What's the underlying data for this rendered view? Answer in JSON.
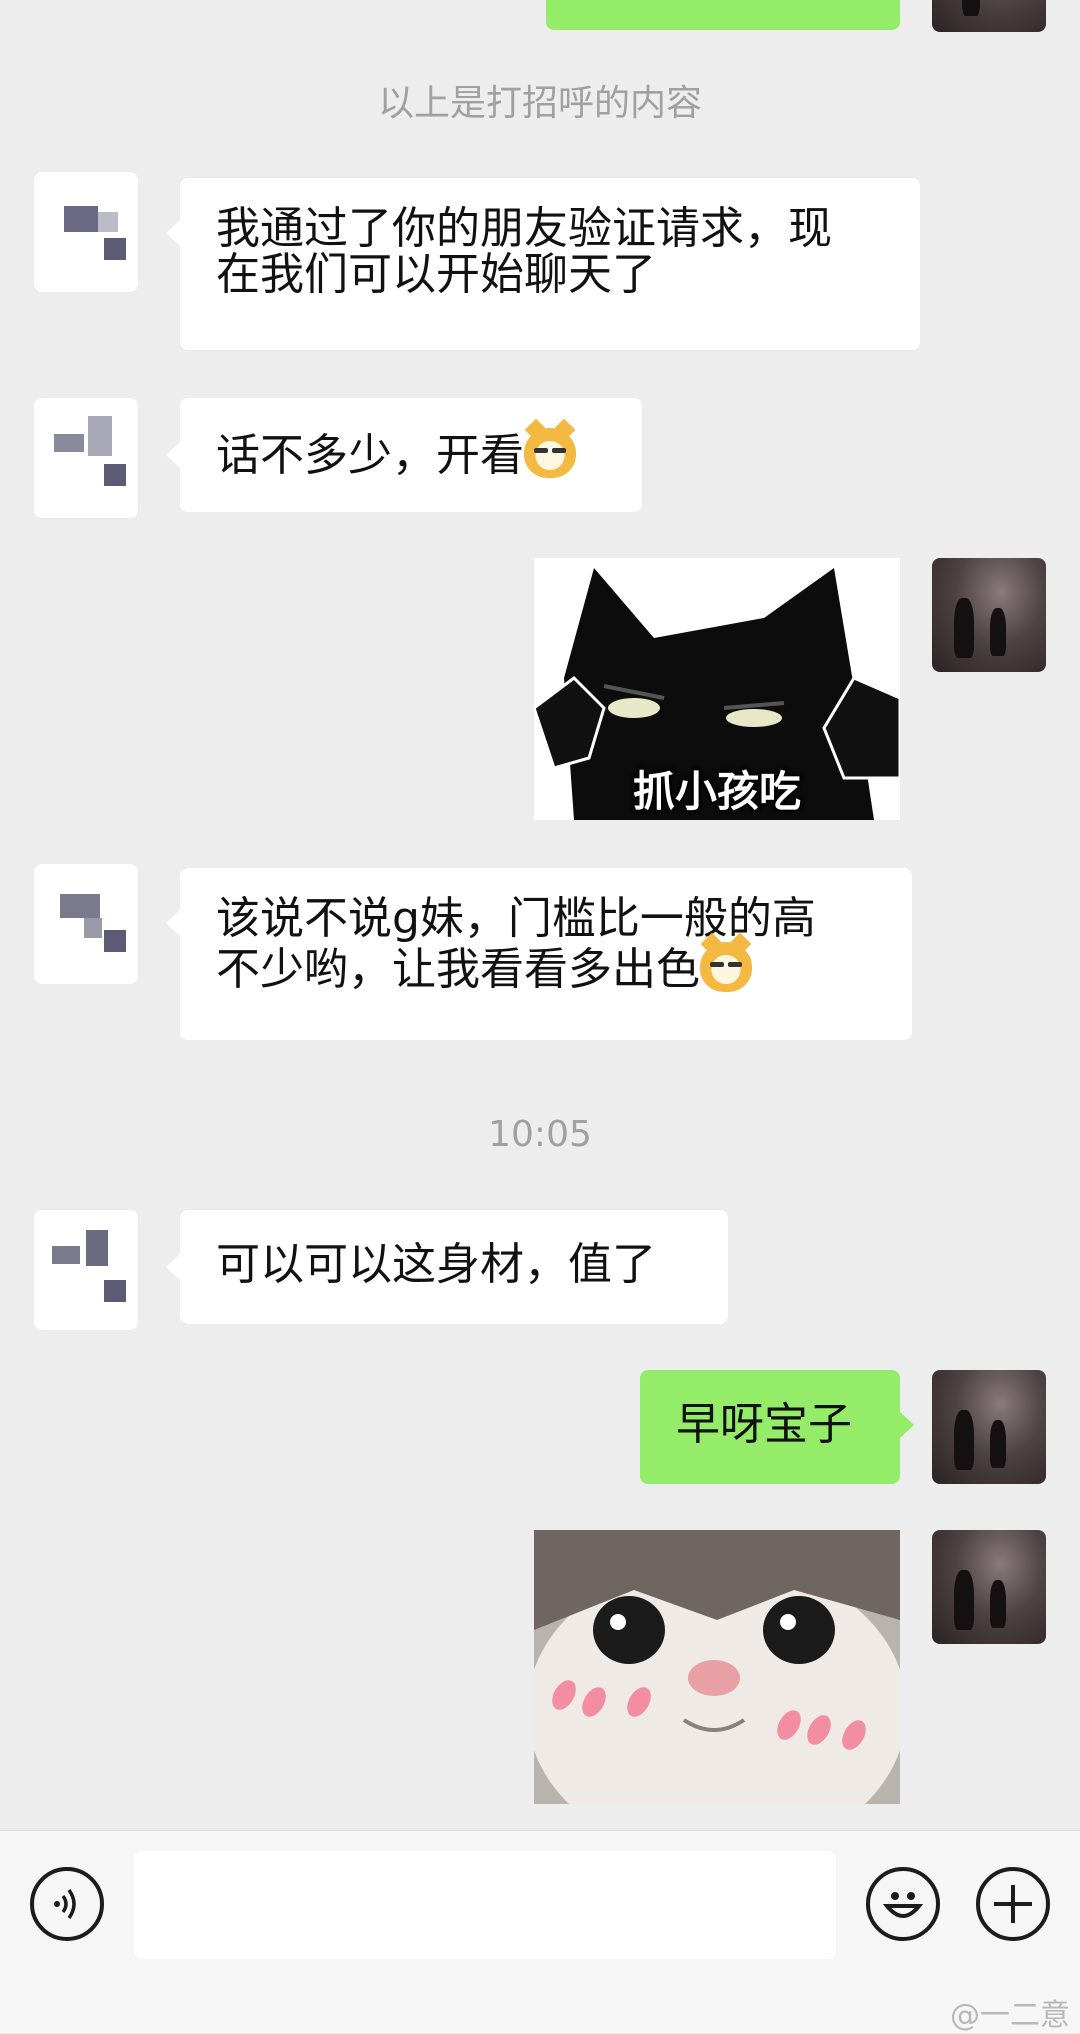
{
  "chat": {
    "system_notice": "以上是打招呼的内容",
    "timestamp": "10:05",
    "messages": [
      {
        "side": "left",
        "text": "我通过了你的朋友验证请求，现在我们可以开始聊天了",
        "line1": "我通过了你的朋友验证请求，现",
        "line2": "在我们可以开始聊天了"
      },
      {
        "side": "left",
        "text": "话不多少，开看",
        "emoji": "doge-emoji"
      },
      {
        "side": "right",
        "type": "sticker",
        "caption": "抓小孩吃"
      },
      {
        "side": "left",
        "line1": "该说不说g妹，门槛比一般的高",
        "line2": "不少哟，让我看看多出色",
        "emoji": "doge-emoji"
      },
      {
        "side": "left",
        "text": "可以可以这身材，值了"
      },
      {
        "side": "right",
        "text": "早呀宝子"
      },
      {
        "side": "right",
        "type": "sticker",
        "caption": ""
      }
    ]
  },
  "input_bar": {
    "voice_icon": "voice-icon",
    "emoji_icon": "smiley-icon",
    "more_icon": "plus-icon",
    "input_value": ""
  },
  "watermark": "@一二意",
  "colors": {
    "background": "#ededed",
    "sent_bubble": "#95ec69",
    "received_bubble": "#ffffff"
  }
}
